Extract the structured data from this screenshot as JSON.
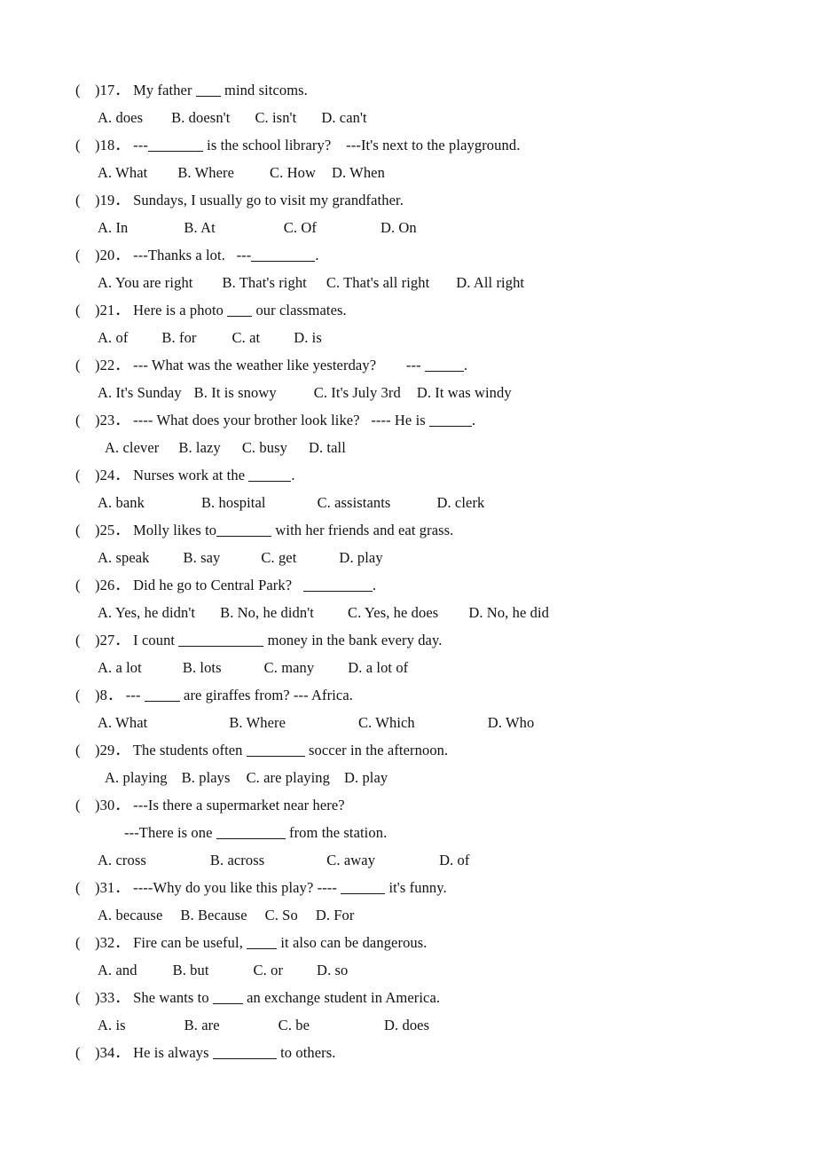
{
  "document": {
    "type": "english-grammar-worksheet",
    "page_text_color": "#121212",
    "background_color": "#ffffff"
  },
  "questions": [
    {
      "paren": "(",
      "number": ")17．",
      "stem_before": "My father ",
      "blank_width": 28,
      "stem_after": " mind sitcoms.",
      "options": [
        {
          "label": "A. does",
          "gap": 32
        },
        {
          "label": "B. doesn't",
          "gap": 28
        },
        {
          "label": "C. isn't",
          "gap": 28
        },
        {
          "label": "D. can't",
          "gap": 0
        }
      ]
    },
    {
      "paren": "(",
      "number": ")18．",
      "stem_before": "---",
      "blank_width": 62,
      "stem_after": " is the school library?    ---It's next to the playground.",
      "options": [
        {
          "label": "A. What",
          "gap": 34
        },
        {
          "label": "B. Where",
          "gap": 40
        },
        {
          "label": "C. How",
          "gap": 18
        },
        {
          "label": "D. When",
          "gap": 0
        }
      ]
    },
    {
      "paren": "(",
      "number": ")19．",
      "stem_before": "Sundays, I usually go to visit my grandfather.",
      "blank_width": 0,
      "stem_after": "",
      "options": [
        {
          "label": "A. In",
          "gap": 63
        },
        {
          "label": "B. At",
          "gap": 77
        },
        {
          "label": "C. Of",
          "gap": 72
        },
        {
          "label": "D. On",
          "gap": 0
        }
      ]
    },
    {
      "paren": "(",
      "number": ")20．",
      "stem_before": "---Thanks a lot.   ---",
      "blank_width": 72,
      "stem_after": ".",
      "options": [
        {
          "label": "A. You are right",
          "gap": 33
        },
        {
          "label": "B. That's right",
          "gap": 22
        },
        {
          "label": "C. That's all right",
          "gap": 30
        },
        {
          "label": "D. All right",
          "gap": 0
        }
      ]
    },
    {
      "paren": "(",
      "number": ")21．",
      "stem_before": "Here is a photo ",
      "blank_width": 28,
      "stem_after": " our classmates.",
      "options": [
        {
          "label": "A. of",
          "gap": 38
        },
        {
          "label": "B. for",
          "gap": 40
        },
        {
          "label": "C. at",
          "gap": 38
        },
        {
          "label": "D. is",
          "gap": 0
        }
      ]
    },
    {
      "paren": "(",
      "number": ")22．",
      "stem_before": "--- What was the weather like yesterday?        --- ",
      "blank_width": 44,
      "stem_after": ".",
      "options": [
        {
          "label": "A. It's Sunday",
          "gap": 14
        },
        {
          "label": "B. It is snowy",
          "gap": 42
        },
        {
          "label": "C. It's July 3rd",
          "gap": 18
        },
        {
          "label": "D. It was windy",
          "gap": 0
        }
      ]
    },
    {
      "paren": "(",
      "number": ")23．",
      "stem_before": "---- What does your brother look like?   ---- He is ",
      "blank_width": 48,
      "stem_after": ".",
      "options_indent": true,
      "options": [
        {
          "label": "A. clever",
          "gap": 22
        },
        {
          "label": "B. lazy",
          "gap": 24
        },
        {
          "label": "C. busy",
          "gap": 24
        },
        {
          "label": "D. tall",
          "gap": 0
        }
      ]
    },
    {
      "paren": "(",
      "number": ")24．",
      "stem_before": "Nurses work at the ",
      "blank_width": 48,
      "stem_after": ".",
      "options": [
        {
          "label": "A. bank",
          "gap": 64
        },
        {
          "label": "B. hospital",
          "gap": 58
        },
        {
          "label": "C. assistants",
          "gap": 52
        },
        {
          "label": "D. clerk",
          "gap": 0
        }
      ]
    },
    {
      "paren": "(",
      "number": ")25．",
      "stem_before": "Molly likes to",
      "blank_width": 62,
      "stem_after": " with her friends and eat grass.",
      "options": [
        {
          "label": "A. speak",
          "gap": 38
        },
        {
          "label": "B. say",
          "gap": 46
        },
        {
          "label": "C. get",
          "gap": 48
        },
        {
          "label": "D. play",
          "gap": 0
        }
      ]
    },
    {
      "paren": "(",
      "number": ")26．",
      "stem_before": "Did he go to Central Park?   ",
      "blank_width": 78,
      "stem_after": ".",
      "options": [
        {
          "label": "A. Yes, he didn't",
          "gap": 28
        },
        {
          "label": "B. No, he didn't",
          "gap": 38
        },
        {
          "label": "C. Yes, he does",
          "gap": 34
        },
        {
          "label": "D. No, he did",
          "gap": 0
        }
      ]
    },
    {
      "paren": "(",
      "number": ")27．",
      "stem_before": "I count ",
      "blank_width": 96,
      "stem_after": " money in the bank every day.",
      "options": [
        {
          "label": "A. a lot",
          "gap": 46
        },
        {
          "label": "B. lots",
          "gap": 48
        },
        {
          "label": "C. many",
          "gap": 38
        },
        {
          "label": "D. a lot of",
          "gap": 0
        }
      ]
    },
    {
      "paren": "(",
      "number": ")8．",
      "stem_before": "--- ",
      "blank_width": 40,
      "stem_after": " are giraffes from? --- Africa.",
      "options": [
        {
          "label": "A. What",
          "gap": 92
        },
        {
          "label": "B. Where",
          "gap": 82
        },
        {
          "label": "C. Which",
          "gap": 82
        },
        {
          "label": "D. Who",
          "gap": 0
        }
      ]
    },
    {
      "paren": "(",
      "number": ")29．",
      "stem_before": "The students often ",
      "blank_width": 66,
      "stem_after": " soccer in the afternoon.",
      "options_indent": true,
      "options": [
        {
          "label": "A. playing",
          "gap": 16
        },
        {
          "label": "B. plays",
          "gap": 18
        },
        {
          "label": "C. are playing",
          "gap": 16
        },
        {
          "label": "D. play",
          "gap": 0
        }
      ]
    },
    {
      "paren": "(",
      "number": ")30．",
      "stem_before": "---Is there a supermarket near here?",
      "blank_width": 0,
      "stem_after": "",
      "stem_line2_before": "---There is one ",
      "stem_line2_blank": 78,
      "stem_line2_after": " from the station.",
      "options": [
        {
          "label": "A. cross",
          "gap": 72
        },
        {
          "label": "B. across",
          "gap": 70
        },
        {
          "label": "C. away",
          "gap": 72
        },
        {
          "label": "D. of",
          "gap": 0
        }
      ]
    },
    {
      "paren": "(",
      "number": ")31．",
      "stem_before": "----Why do you like this play? ---- ",
      "blank_width": 50,
      "stem_after": " it's funny.",
      "options": [
        {
          "label": "A. because",
          "gap": 20
        },
        {
          "label": "B. Because",
          "gap": 20
        },
        {
          "label": "C. So",
          "gap": 20
        },
        {
          "label": "D. For",
          "gap": 0
        }
      ]
    },
    {
      "paren": "(",
      "number": ")32．",
      "stem_before": "Fire can be useful, ",
      "blank_width": 34,
      "stem_after": " it also can be dangerous.",
      "options": [
        {
          "label": "A. and",
          "gap": 40
        },
        {
          "label": "B. but",
          "gap": 50
        },
        {
          "label": "C. or",
          "gap": 38
        },
        {
          "label": "D. so",
          "gap": 0
        }
      ]
    },
    {
      "paren": "(",
      "number": ")33．",
      "stem_before": "She wants to ",
      "blank_width": 34,
      "stem_after": " an exchange student in America.",
      "options": [
        {
          "label": "A. is",
          "gap": 66
        },
        {
          "label": "B. are",
          "gap": 66
        },
        {
          "label": "C. be",
          "gap": 84
        },
        {
          "label": "D. does",
          "gap": 0
        }
      ]
    },
    {
      "paren": "(",
      "number": ")34．",
      "stem_before": "He is always ",
      "blank_width": 72,
      "stem_after": " to others.",
      "options": []
    }
  ]
}
